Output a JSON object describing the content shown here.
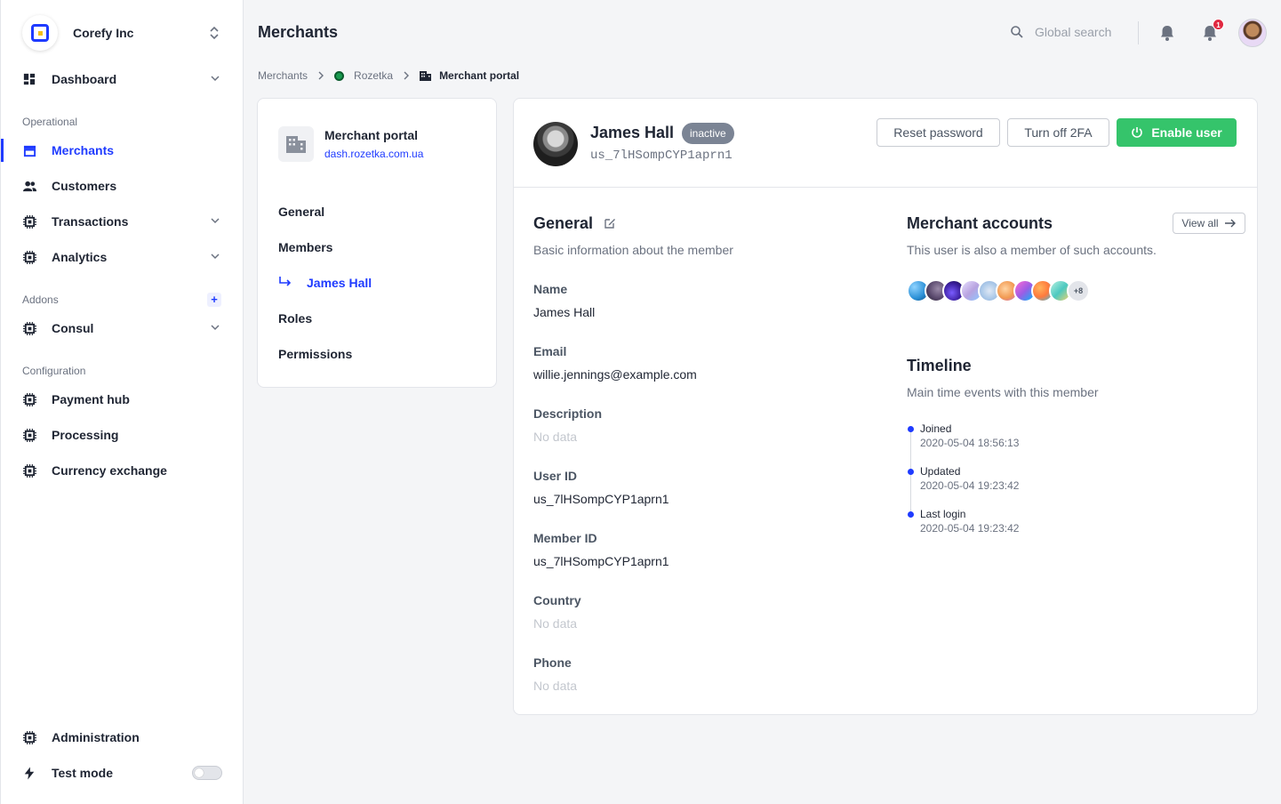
{
  "org": {
    "name": "Corefy Inc"
  },
  "sidebar": {
    "top_items": [
      {
        "label": "Dashboard",
        "icon": "dashboard-icon"
      }
    ],
    "operational": {
      "label": "Operational",
      "items": [
        {
          "label": "Merchants",
          "icon": "store-icon",
          "active": true
        },
        {
          "label": "Customers",
          "icon": "users-icon"
        },
        {
          "label": "Transactions",
          "icon": "chip-icon"
        },
        {
          "label": "Analytics",
          "icon": "chip-icon"
        }
      ]
    },
    "addons": {
      "label": "Addons",
      "items": [
        {
          "label": "Consul",
          "icon": "chip-icon"
        }
      ]
    },
    "configuration": {
      "label": "Configuration",
      "items": [
        {
          "label": "Payment hub",
          "icon": "chip-icon"
        },
        {
          "label": "Processing",
          "icon": "chip-icon"
        },
        {
          "label": "Currency exchange",
          "icon": "chip-icon"
        }
      ]
    },
    "bottom": {
      "administration": "Administration",
      "test_mode": "Test mode",
      "test_mode_on": false
    }
  },
  "header": {
    "title": "Merchants",
    "search_placeholder": "Global search",
    "notification_count": "1"
  },
  "breadcrumb": [
    "Merchants",
    "Rozetka",
    "Merchant portal"
  ],
  "merchant_card": {
    "title": "Merchant portal",
    "link": "dash.rozetka.com.ua",
    "menu": [
      "General",
      "Members",
      "James Hall",
      "Roles",
      "Permissions"
    ]
  },
  "profile": {
    "name": "James Hall",
    "status": "inactive",
    "id": "us_7lHSompCYP1aprn1",
    "buttons": {
      "reset": "Reset password",
      "twofa": "Turn off 2FA",
      "enable": "Enable user"
    }
  },
  "general": {
    "title": "General",
    "subtitle": "Basic information about the member",
    "fields": [
      {
        "label": "Name",
        "value": "James Hall"
      },
      {
        "label": "Email",
        "value": "willie.jennings@example.com"
      },
      {
        "label": "Description",
        "value": "No data",
        "empty": true
      },
      {
        "label": "User ID",
        "value": "us_7lHSompCYP1aprn1"
      },
      {
        "label": "Member ID",
        "value": "us_7lHSompCYP1aprn1"
      },
      {
        "label": "Country",
        "value": "No data",
        "empty": true
      },
      {
        "label": "Phone",
        "value": "No data",
        "empty": true
      }
    ]
  },
  "accounts": {
    "title": "Merchant accounts",
    "subtitle": "This user is also a member of such accounts.",
    "view_all": "View all",
    "more": "+8",
    "colors": [
      "#2a8fd6",
      "#5b4a6e",
      "#3b1f9e",
      "#b8a3e0",
      "#a9c7e8",
      "#f29a52",
      "#9b5de5",
      "#ff7a3d",
      "#4cc9c0"
    ]
  },
  "timeline": {
    "title": "Timeline",
    "subtitle": "Main time events with this member",
    "events": [
      {
        "label": "Joined",
        "time": "2020-05-04 18:56:13"
      },
      {
        "label": "Updated",
        "time": "2020-05-04 19:23:42"
      },
      {
        "label": "Last login",
        "time": "2020-05-04 19:23:42"
      }
    ]
  }
}
